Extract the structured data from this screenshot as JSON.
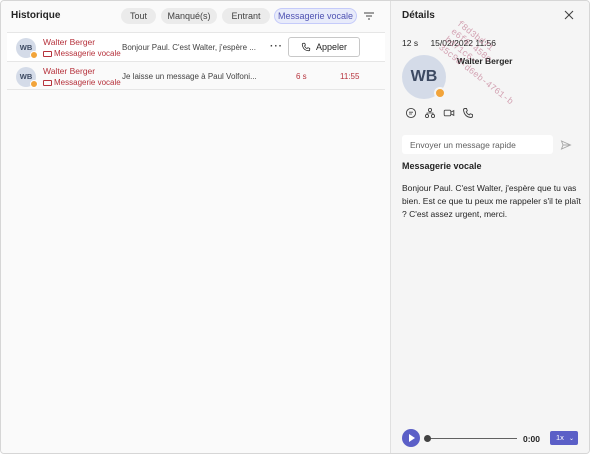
{
  "history": {
    "title": "Historique",
    "tabs": [
      {
        "label": "Tout",
        "active": false
      },
      {
        "label": "Manqué(s)",
        "active": false
      },
      {
        "label": "Entrant",
        "active": false
      },
      {
        "label": "Messagerie vocale",
        "active": true
      }
    ],
    "filter_icon": "filter-icon",
    "calls": [
      {
        "initials": "WB",
        "name": "Walter Berger",
        "type": "Messagerie vocale",
        "preview": "Bonjour Paul. C'est Walter, j'espère ...",
        "more": "···",
        "call_label": "Appeler"
      },
      {
        "initials": "WB",
        "name": "Walter Berger",
        "type": "Messagerie vocale",
        "preview": "Je laisse un message à Paul Volfoni...",
        "duration": "6 s",
        "time": "11:55"
      }
    ]
  },
  "details": {
    "title": "Détails",
    "duration": "12 s",
    "datetime": "15/02/2022 11:56",
    "initials": "WB",
    "name": "Walter Berger",
    "actions": [
      "chat-icon",
      "org-chart-icon",
      "video-icon",
      "phone-icon"
    ],
    "quick_message_placeholder": "Envoyer un message rapide",
    "voicemail_title": "Messagerie vocale",
    "voicemail_text": "Bonjour Paul. C'est Walter, j'espère que tu vas bien. Est ce que tu peux me rappeler s'il te plaît ? C'est assez urgent, merci.",
    "player": {
      "position": "0:00",
      "speed": "1x",
      "progress": 0
    }
  },
  "watermark": [
    "f8d3bd71",
    "e6f6-458c",
    "bd71c6-",
    "35c9d-d6eb-4761-b"
  ],
  "colors": {
    "accent": "#5b5fc7",
    "missed_red": "#b6323c",
    "presence_away": "#f2a43a"
  }
}
